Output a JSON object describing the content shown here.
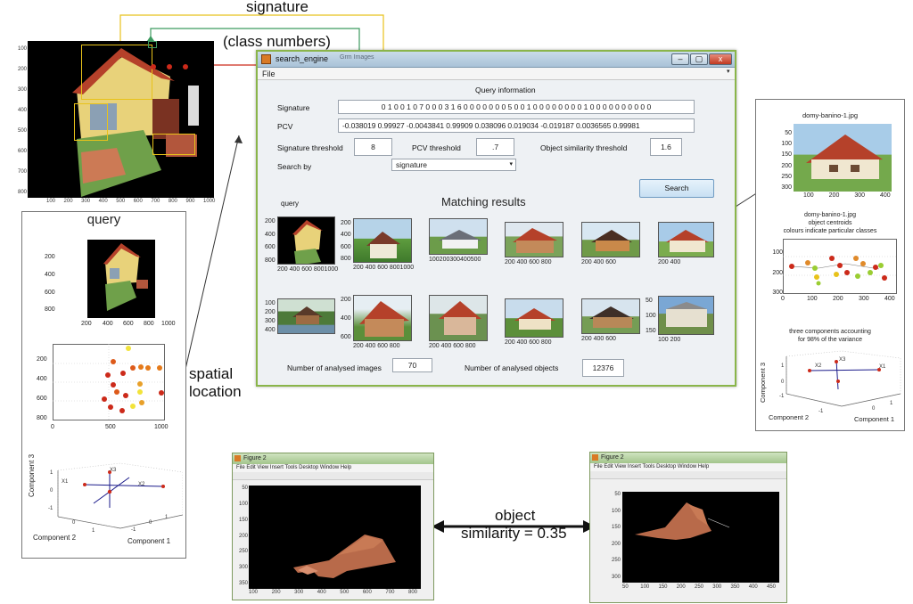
{
  "annotations": {
    "signature": "signature",
    "class_numbers": "(class numbers)",
    "spatial_location": "spatial\nlocation",
    "object": "object",
    "similarity": "similarity = 0.35"
  },
  "query_panel": {
    "title": "query",
    "img_xticks": [
      "200",
      "400",
      "600",
      "800",
      "1000"
    ],
    "img_yticks": [
      "200",
      "400",
      "600",
      "800"
    ],
    "scatter_xticks": [
      "0",
      "500",
      "1000"
    ],
    "scatter_yticks": [
      "200",
      "400",
      "600",
      "800"
    ],
    "c3_label": "Component 3",
    "c2_label": "Component 2",
    "c1_label": "Component 1",
    "axis_ticks": [
      "1",
      "0",
      "-1",
      "0",
      "1",
      "-1",
      "0",
      "1"
    ],
    "axis_tags": [
      "X1",
      "X2",
      "X3"
    ]
  },
  "top_left_image": {
    "xticks": [
      "100",
      "200",
      "300",
      "400",
      "500",
      "600",
      "700",
      "800",
      "900",
      "1000"
    ],
    "yticks": [
      "100",
      "200",
      "300",
      "400",
      "500",
      "600",
      "700",
      "800"
    ]
  },
  "window": {
    "title": "search_engine",
    "title_extra": "Grm Images",
    "controls": [
      "–",
      "▢",
      "x"
    ],
    "menu": [
      "File"
    ],
    "section_title": "Query information",
    "signature_label": "Signature",
    "signature_value": "0 1 0 0 1 0 7 0 0 0 3 1 6 0 0 0 0 0 0 0 5 0 0 1 0 0 0 0 0 0 0 0 1 0 0 0 0 0 0 0 0 0 0",
    "pcv_label": "PCV",
    "pcv_value": "-0.038019    0.99927   -0.0043841    0.99909   0.038096   0.019034   -0.019187   0.0036565   0.99981",
    "sig_threshold_label": "Signature threshold",
    "sig_threshold_value": "8",
    "pcv_threshold_label": "PCV threshold",
    "pcv_threshold_value": ".7",
    "obj_threshold_label": "Object similarity threshold",
    "obj_threshold_value": "1.6",
    "search_by_label": "Search by",
    "search_by_value": "signature",
    "search_button": "Search",
    "results_title": "Matching results",
    "query_label": "query",
    "thumb_labels": [
      {
        "y": [
          "200",
          "400",
          "600",
          "800"
        ],
        "x": "200 400 600 8001000"
      },
      {
        "y": [
          "200",
          "400",
          "600",
          "800"
        ],
        "x": "200 400 600 8001000"
      },
      {
        "y": [],
        "x": "100200300400500"
      },
      {
        "y": [],
        "x": "200 400 600 800"
      },
      {
        "y": [],
        "x": "200  400  600"
      },
      {
        "y": [],
        "x": "200     400"
      },
      {
        "y": [
          "100",
          "200",
          "300",
          "400"
        ],
        "x": ""
      },
      {
        "y": [
          "200",
          "400",
          "600"
        ],
        "x": "200 400 600 800"
      },
      {
        "y": [],
        "x": "200 400 600 800"
      },
      {
        "y": [],
        "x": "200 400 600 800"
      },
      {
        "y": [],
        "x": "200  400  600"
      },
      {
        "y": [
          "50",
          "100",
          "150"
        ],
        "x": "100      200"
      }
    ],
    "analysed_images_label": "Number of analysed images",
    "analysed_images_value": "70",
    "analysed_objects_label": "Number of analysed objects",
    "analysed_objects_value": "12376"
  },
  "right_panel": {
    "img_title": "domy-banino-1.jpg",
    "img_yticks": [
      "50",
      "100",
      "150",
      "200",
      "250",
      "300"
    ],
    "img_xticks": [
      "100",
      "200",
      "300",
      "400"
    ],
    "centroid_title1": "domy-banino-1.jpg",
    "centroid_title2": "object centroids",
    "centroid_title3": "colours indicate particular classes",
    "cent_yticks": [
      "100",
      "200",
      "300"
    ],
    "cent_xticks": [
      "0",
      "100",
      "200",
      "300",
      "400"
    ],
    "pca_title1": "three components accounting",
    "pca_title2": "for 98% of the variance",
    "c3_label": "Component 3",
    "c2_label": "Component 2",
    "c1_label": "Component 1",
    "axis_tags": [
      "X1",
      "X2",
      "X3"
    ],
    "axis_ticks": [
      "0",
      "-1",
      "1",
      "-1",
      "0",
      "1"
    ]
  },
  "figure_left": {
    "title": "Figure 2",
    "menu": "File  Edit  View  Insert  Tools  Desktop  Window  Help",
    "xticks": [
      "100",
      "200",
      "300",
      "400",
      "500",
      "600",
      "700",
      "800"
    ],
    "yticks": [
      "50",
      "100",
      "150",
      "200",
      "250",
      "300",
      "350"
    ]
  },
  "figure_right": {
    "title": "Figure 2",
    "menu": "File  Edit  View  Insert  Tools  Desktop  Window  Help",
    "xticks": [
      "50",
      "100",
      "150",
      "200",
      "250",
      "300",
      "350",
      "400",
      "450"
    ],
    "yticks": [
      "50",
      "100",
      "150",
      "200",
      "250",
      "300"
    ]
  },
  "colors": {
    "accent_red": "#cc2a1a",
    "accent_yellow": "#e8c21a",
    "accent_green": "#3c9a5f",
    "window_border": "#8ab54a"
  }
}
